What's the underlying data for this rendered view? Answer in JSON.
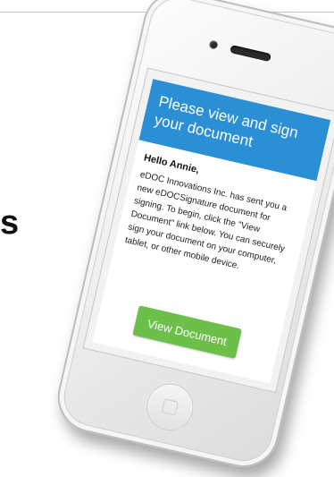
{
  "side_text": "s",
  "email": {
    "title": "Please view and sign your document",
    "greeting": "Hello Annie,",
    "message": "eDOC Innovations Inc. has sent you a new eDOCSignature document for signing. To begin, click the \"View Document\" link below. You can securely sign your document on your computer, tablet, or other mobile device.",
    "button_label": "View Document"
  },
  "colors": {
    "header": "#2b8fd6",
    "button": "#6cc04a"
  },
  "icons": {
    "camera": "camera-icon",
    "speaker": "speaker-icon",
    "home": "home-button-icon"
  }
}
